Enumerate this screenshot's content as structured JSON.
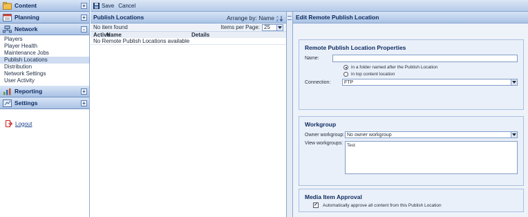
{
  "nav": {
    "sections": [
      {
        "label": "Content",
        "toggle": "+"
      },
      {
        "label": "Planning",
        "toggle": "+"
      },
      {
        "label": "Network",
        "toggle": "-"
      },
      {
        "label": "Reporting",
        "toggle": "+"
      },
      {
        "label": "Settings",
        "toggle": "+"
      }
    ],
    "network_items": [
      "Players",
      "Player Health",
      "Maintenance Jobs",
      "Publish Locations",
      "Distribution",
      "Network Settings",
      "User Activity"
    ],
    "logout": "Logout"
  },
  "toolbar": {
    "save": "Save",
    "cancel": "Cancel"
  },
  "list": {
    "title": "Publish Locations",
    "arrange_label": "Arrange by: Name",
    "no_item": "No item found",
    "items_per_page_label": "Items per Page:",
    "items_per_page": "25",
    "columns": [
      "Active",
      "Name",
      "Details"
    ],
    "empty": "No Remote Publish Locations available"
  },
  "edit": {
    "title": "Edit Remote Publish Location",
    "props_legend": "Remote Publish Location Properties",
    "name_label": "Name:",
    "name_value": "",
    "radio_folder": "in a folder named after the Publish Location",
    "radio_top": "in top content location",
    "connection_label": "Connection:",
    "connection_value": "FTP",
    "workgroup_legend": "Workgroup",
    "owner_label": "Owner workgroup:",
    "owner_value": "No owner workgroup",
    "view_label": "View workgroups:",
    "view_value": "Test",
    "approval_legend": "Media Item Approval",
    "approval_text": "Automatically approve all content from this Publish Location"
  }
}
